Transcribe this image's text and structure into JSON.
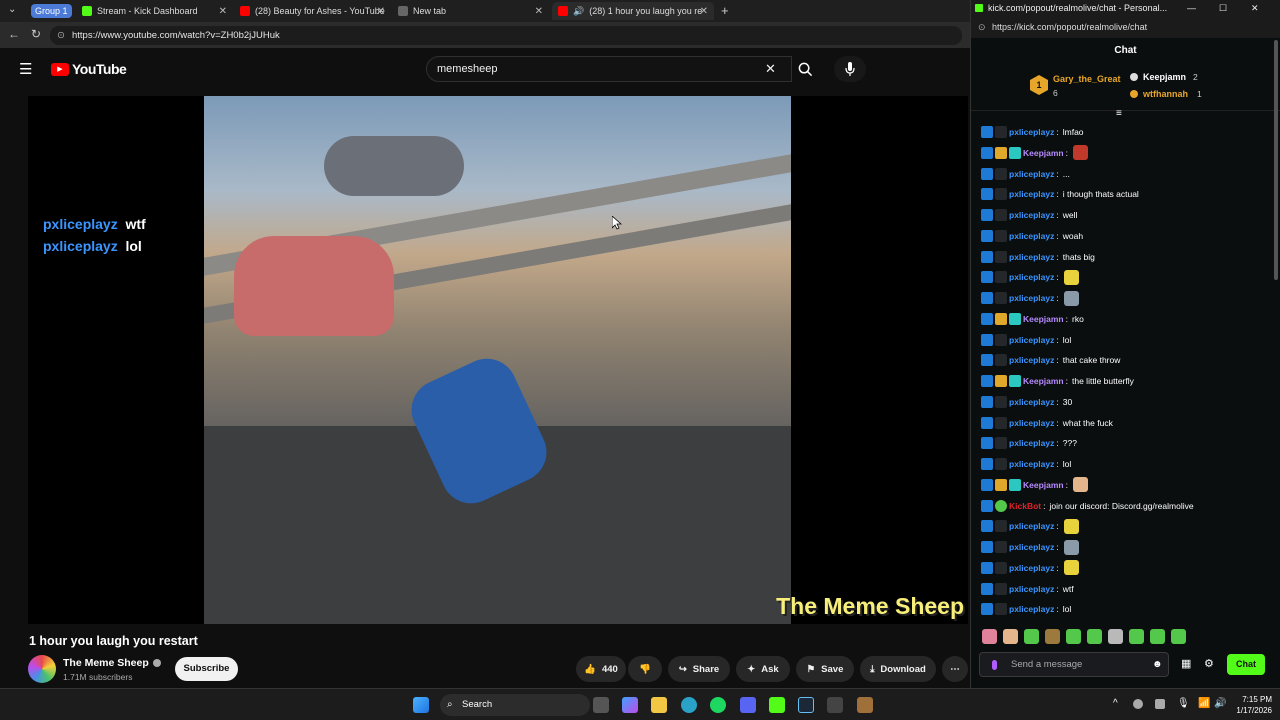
{
  "browser": {
    "group_label": "Group 1",
    "tabs": [
      {
        "label": "Stream - Kick Dashboard",
        "color": "#53fc18"
      },
      {
        "label": "(28) Beauty for Ashes - YouTube",
        "color": "#ff0000"
      },
      {
        "label": "New tab",
        "color": "#888888"
      },
      {
        "label": "(28) 1 hour you laugh you re",
        "color": "#ff0000"
      }
    ],
    "url": "https://www.youtube.com/watch?v=ZH0b2jJUHuk"
  },
  "youtube": {
    "logo_text": "YouTube",
    "search_value": "memesheep",
    "overlay_lines": [
      {
        "user": "pxliceplayz",
        "text": "wtf"
      },
      {
        "user": "pxliceplayz",
        "text": "lol"
      }
    ],
    "watermark": "The Meme Sheep",
    "video_title": "1 hour you laugh you restart",
    "channel_name": "The Meme Sheep",
    "subscribers": "1.71M subscribers",
    "subscribe_label": "Subscribe",
    "like_count": "440",
    "share_label": "Share",
    "ask_label": "Ask",
    "save_label": "Save",
    "download_label": "Download"
  },
  "chat": {
    "window_title": "kick.com/popout/realmolive/chat - Personal...",
    "url": "https://kick.com/popout/realmolive/chat",
    "header": "Chat",
    "leaderboard": [
      {
        "rank": "1",
        "name": "Gary_the_Great",
        "count": "6"
      },
      {
        "rank": "",
        "name": "Keepjamn",
        "count": "2"
      },
      {
        "rank": "",
        "name": "wtfhannah",
        "count": "1"
      }
    ],
    "messages": [
      {
        "user": "pxliceplayz",
        "text": "lmfao",
        "color": "#3b95ff",
        "emote": ""
      },
      {
        "user": "Keepjamn",
        "text": "",
        "color": "#b68bff",
        "emote": "#c0392b"
      },
      {
        "user": "pxliceplayz",
        "text": "...",
        "color": "#3b95ff",
        "emote": ""
      },
      {
        "user": "pxliceplayz",
        "text": "i though thats actual",
        "color": "#3b95ff",
        "emote": ""
      },
      {
        "user": "pxliceplayz",
        "text": "well",
        "color": "#3b95ff",
        "emote": ""
      },
      {
        "user": "pxliceplayz",
        "text": "woah",
        "color": "#3b95ff",
        "emote": ""
      },
      {
        "user": "pxliceplayz",
        "text": "thats big",
        "color": "#3b95ff",
        "emote": ""
      },
      {
        "user": "pxliceplayz",
        "text": "",
        "color": "#3b95ff",
        "emote": "#e9d33c"
      },
      {
        "user": "pxliceplayz",
        "text": "",
        "color": "#3b95ff",
        "emote": "#8a9aa8"
      },
      {
        "user": "Keepjamn",
        "text": "rko",
        "color": "#b68bff",
        "emote": ""
      },
      {
        "user": "pxliceplayz",
        "text": "lol",
        "color": "#3b95ff",
        "emote": ""
      },
      {
        "user": "pxliceplayz",
        "text": "that cake throw",
        "color": "#3b95ff",
        "emote": ""
      },
      {
        "user": "Keepjamn",
        "text": "the little butterfly",
        "color": "#b68bff",
        "emote": ""
      },
      {
        "user": "pxliceplayz",
        "text": "30",
        "color": "#3b95ff",
        "emote": ""
      },
      {
        "user": "pxliceplayz",
        "text": "what the fuck",
        "color": "#3b95ff",
        "emote": ""
      },
      {
        "user": "pxliceplayz",
        "text": "???",
        "color": "#3b95ff",
        "emote": ""
      },
      {
        "user": "pxliceplayz",
        "text": "lol",
        "color": "#3b95ff",
        "emote": ""
      },
      {
        "user": "Keepjamn",
        "text": "",
        "color": "#b68bff",
        "emote": "#e5b58c"
      },
      {
        "user": "KickBot",
        "text": "join our discord: Discord.gg/realmolive",
        "color": "#e0232b",
        "emote": ""
      },
      {
        "user": "pxliceplayz",
        "text": "",
        "color": "#3b95ff",
        "emote": "#e9d33c"
      },
      {
        "user": "pxliceplayz",
        "text": "",
        "color": "#3b95ff",
        "emote": "#8a9aa8"
      },
      {
        "user": "pxliceplayz",
        "text": "",
        "color": "#3b95ff",
        "emote": "#e9d33c"
      },
      {
        "user": "pxliceplayz",
        "text": "wtf",
        "color": "#3b95ff",
        "emote": ""
      },
      {
        "user": "pxliceplayz",
        "text": "lol",
        "color": "#3b95ff",
        "emote": ""
      }
    ],
    "input_placeholder": "Send a message",
    "send_label": "Chat"
  },
  "taskbar": {
    "search_label": "Search",
    "time": "7:15 PM",
    "date": "1/17/2026"
  },
  "colors": {
    "kick_green": "#53fc18",
    "youtube_red": "#ff0000",
    "chat_blue": "#3b95ff"
  }
}
